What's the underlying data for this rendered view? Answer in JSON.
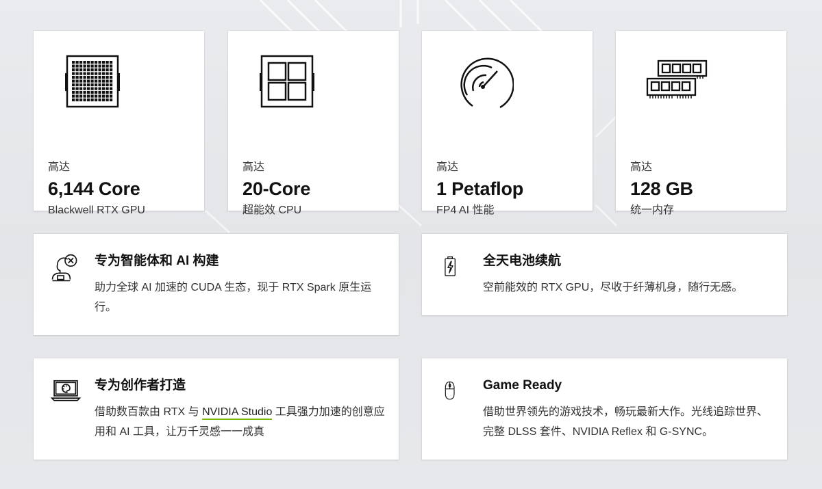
{
  "stats": [
    {
      "pre": "高达",
      "value": "6,144 Core",
      "sub": "Blackwell RTX GPU",
      "icon": "gpu-chip-icon"
    },
    {
      "pre": "高达",
      "value": "20-Core",
      "sub": "超能效 CPU",
      "icon": "cpu-chip-icon"
    },
    {
      "pre": "高达",
      "value": "1 Petaflop",
      "sub": "FP4 AI 性能",
      "icon": "speedometer-icon"
    },
    {
      "pre": "高达",
      "value": "128 GB",
      "sub": "统一内存",
      "icon": "memory-modules-icon"
    }
  ],
  "features": [
    {
      "title": "专为智能体和 AI 构建",
      "desc": "助力全球 AI 加速的 CUDA 生态，现于 RTX Spark 原生运行。",
      "icon": "ai-agent-icon"
    },
    {
      "title": "全天电池续航",
      "desc": "空前能效的 RTX GPU，尽收于纤薄机身，随行无感。",
      "icon": "battery-charging-icon"
    },
    {
      "title": "专为创作者打造",
      "desc_before": "借助数百款由 RTX 与 ",
      "link_text": "NVIDIA Studio",
      "desc_after": " 工具强力加速的创意应用和 AI 工具，让万千灵感一一成真",
      "icon": "laptop-palette-icon"
    },
    {
      "title": "Game Ready",
      "desc": "借助世界领先的游戏技术，畅玩最新大作。光线追踪世界、完整 DLSS 套件、NVIDIA Reflex 和 G-SYNC。",
      "icon": "gaming-mouse-icon"
    }
  ],
  "colors": {
    "accent": "#76b900",
    "background": "#e6e8eb",
    "card": "#ffffff"
  }
}
